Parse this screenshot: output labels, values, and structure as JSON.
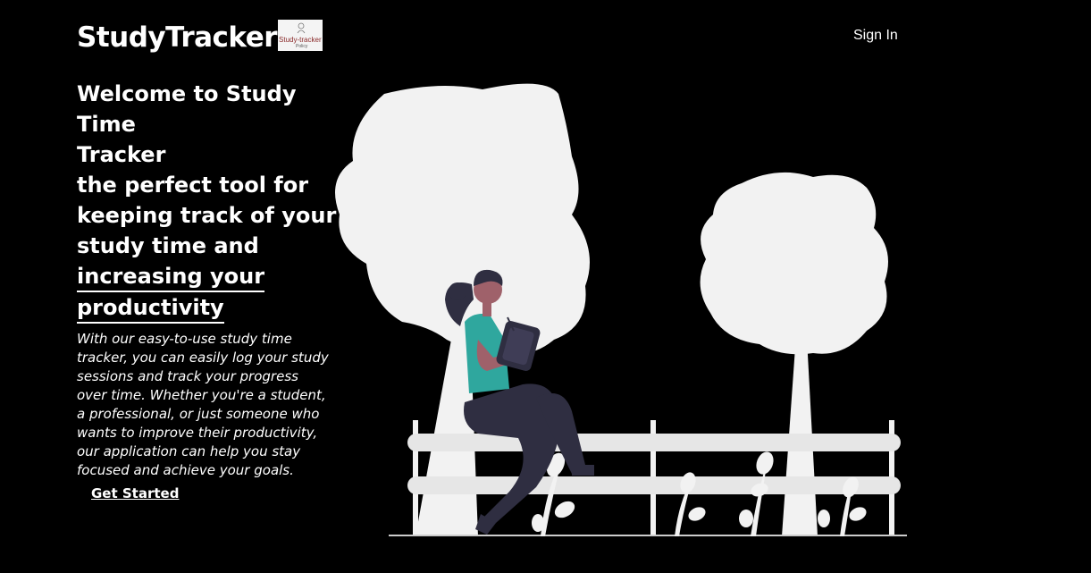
{
  "header": {
    "brand_name": "StudyTracker",
    "logo_text": "Study-tracker",
    "logo_subtext": "Policy",
    "signin_label": "Sign In"
  },
  "hero": {
    "headline_line1": "Welcome to Study Time",
    "headline_line2": "Tracker",
    "headline_line3": "the perfect tool for",
    "headline_line4": "keeping track of your",
    "headline_line5": "study time and",
    "headline_line6": "increasing your",
    "headline_line7": "productivity",
    "description": "With our easy-to-use study time tracker, you can easily log your study sessions and track your progress over time. Whether you're a student, a professional, or just someone who wants to improve their productivity, our application can help you stay focused and achieve your goals.",
    "cta_label": "Get Started"
  },
  "colors": {
    "background": "#000000",
    "text": "#ffffff",
    "illustration_light": "#f2f2f2",
    "shirt": "#2fa79e",
    "pants": "#2f2e41",
    "skin": "#9f616a"
  }
}
